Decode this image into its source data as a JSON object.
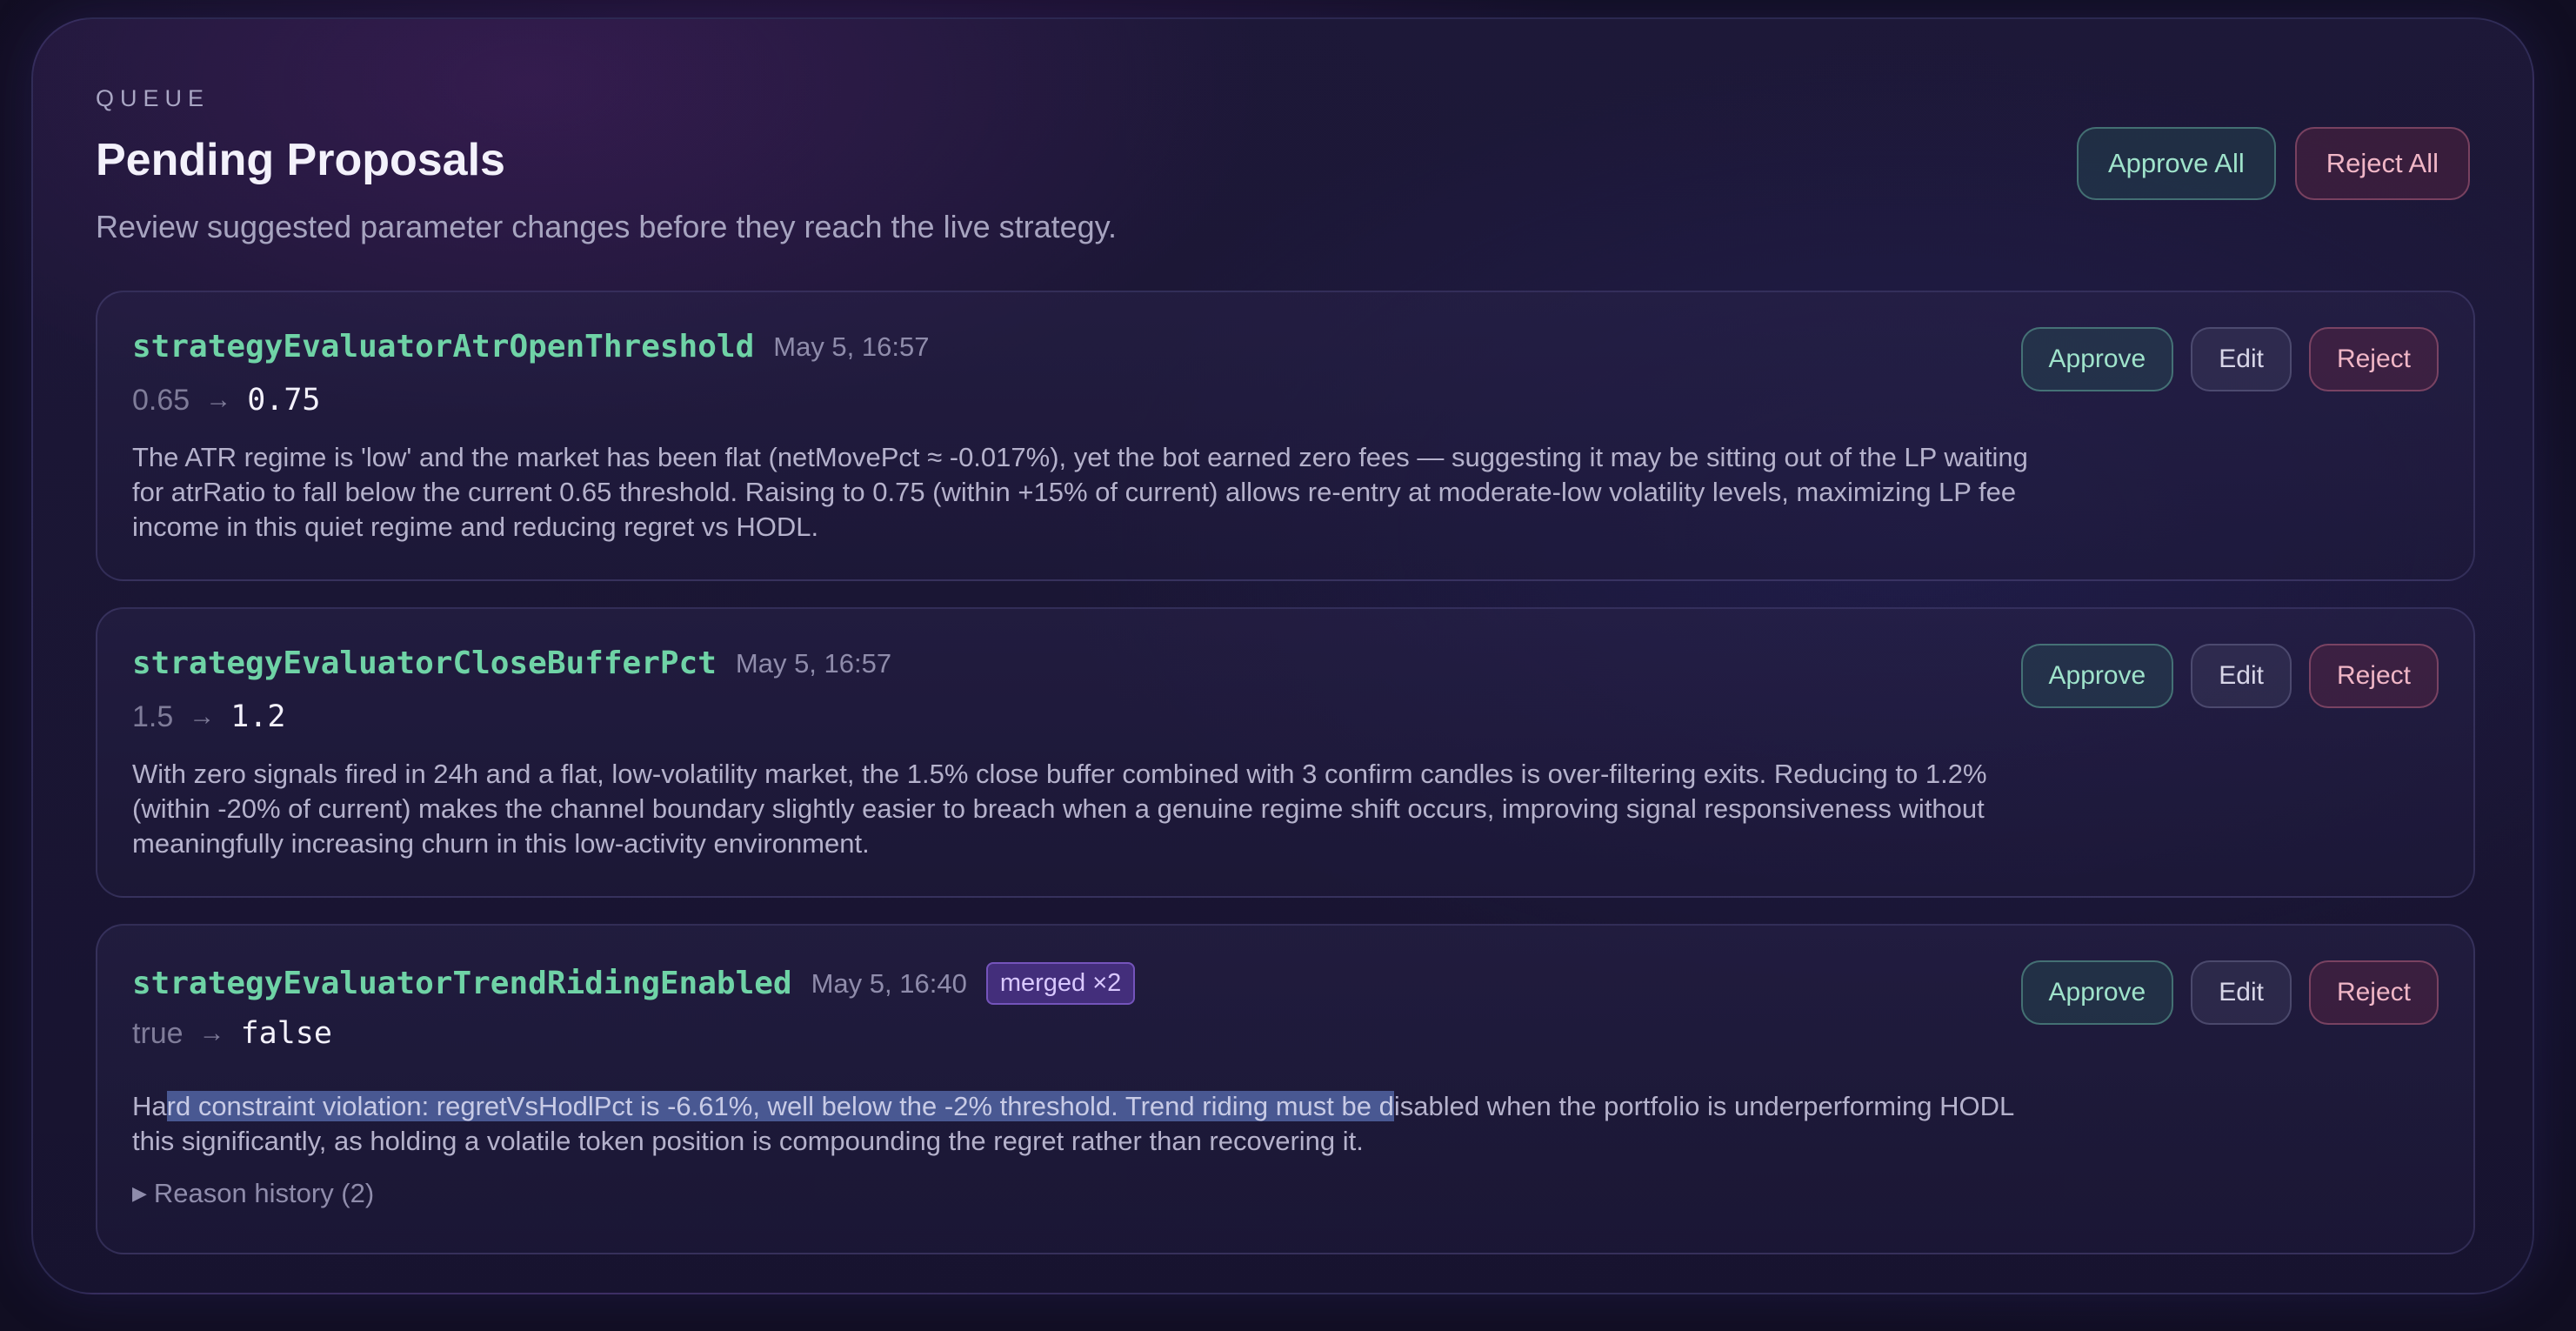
{
  "header": {
    "eyebrow": "QUEUE",
    "title": "Pending Proposals",
    "subtitle": "Review suggested parameter changes before they reach the live strategy.",
    "approve_all_label": "Approve All",
    "reject_all_label": "Reject All"
  },
  "actions": {
    "approve_label": "Approve",
    "edit_label": "Edit",
    "reject_label": "Reject",
    "arrow": "→"
  },
  "proposals": [
    {
      "param": "strategyEvaluatorAtrOpenThreshold",
      "timestamp": "May 5, 16:57",
      "old_value": "0.65",
      "new_value": "0.75",
      "reason": "The ATR regime is 'low' and the market has been flat (netMovePct ≈ -0.017%), yet the bot earned zero fees — suggesting it may be sitting out of the LP waiting for atrRatio to fall below the current 0.65 threshold. Raising to 0.75 (within +15% of current) allows re-entry at moderate-low volatility levels, maximizing LP fee income in this quiet regime and reducing regret vs HODL."
    },
    {
      "param": "strategyEvaluatorCloseBufferPct",
      "timestamp": "May 5, 16:57",
      "old_value": "1.5",
      "new_value": "1.2",
      "reason": "With zero signals fired in 24h and a flat, low-volatility market, the 1.5% close buffer combined with 3 confirm candles is over-filtering exits. Reducing to 1.2% (within -20% of current) makes the channel boundary slightly easier to breach when a genuine regime shift occurs, improving signal responsiveness without meaningfully increasing churn in this low-activity environment."
    },
    {
      "param": "strategyEvaluatorTrendRidingEnabled",
      "timestamp": "May 5, 16:40",
      "badge": "merged ×2",
      "old_value": "true",
      "new_value": "false",
      "reason_before": "Ha",
      "reason_highlight": "rd constraint violation: regretVsHodlPct is -6.61%, well below the -2% threshold. Trend riding must be d",
      "reason_after": "isabled when the portfolio is underperforming HODL this significantly, as holding a volatile token position is compounding the regret rather than recovering it.",
      "history_label": "Reason history (2)",
      "history_caret": "▶"
    }
  ]
}
